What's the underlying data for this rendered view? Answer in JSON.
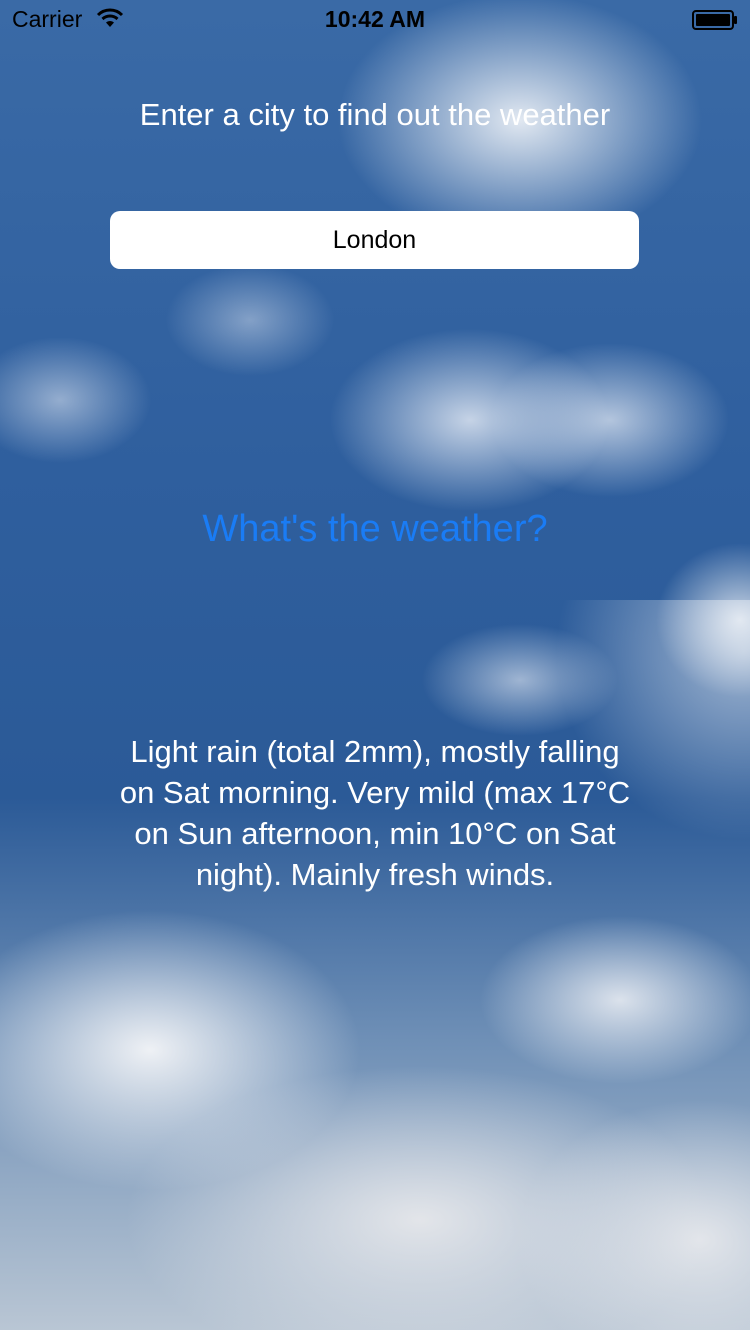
{
  "status_bar": {
    "carrier": "Carrier",
    "time": "10:42 AM",
    "wifi_icon": "wifi-icon",
    "battery_icon": "battery-icon"
  },
  "main": {
    "prompt": "Enter a city to find out the weather",
    "city_input": {
      "value": "London",
      "placeholder": ""
    },
    "button_label": "What's the weather?",
    "forecast": "Light rain (total 2mm), mostly falling on Sat morning. Very mild (max 17°C on Sun afternoon, min 10°C on Sat night). Mainly fresh winds."
  },
  "colors": {
    "accent": "#1a7cf5",
    "text": "#ffffff"
  }
}
